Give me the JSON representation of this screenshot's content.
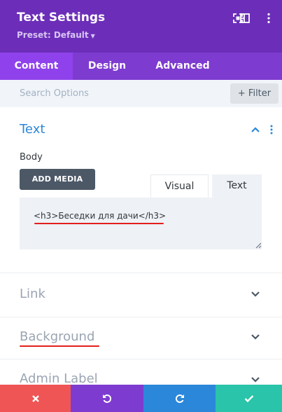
{
  "header": {
    "title": "Text Settings",
    "preset_label": "Preset: Default",
    "icons": [
      "expand-icon",
      "split-view-icon",
      "more-vertical-icon"
    ]
  },
  "tabs": [
    {
      "label": "Content",
      "active": true
    },
    {
      "label": "Design",
      "active": false
    },
    {
      "label": "Advanced",
      "active": false
    }
  ],
  "search": {
    "placeholder": "Search Options",
    "filter_label": "Filter"
  },
  "text_section": {
    "title": "Text",
    "body_label": "Body",
    "add_media_label": "ADD MEDIA",
    "editor_tabs": [
      "Visual",
      "Text"
    ],
    "active_editor_tab": "Text",
    "content": "<h3>Беседки для дачи</h3>"
  },
  "sections": [
    {
      "title": "Link"
    },
    {
      "title": "Background"
    },
    {
      "title": "Admin Label"
    }
  ],
  "footer": {
    "buttons": [
      "close-button",
      "undo-button",
      "redo-button",
      "save-button"
    ],
    "colors": [
      "#ef5555",
      "#7e3bd0",
      "#2b87da",
      "#29c4a9"
    ]
  },
  "colors": {
    "header_bg": "#6c2eb9",
    "tabs_bg": "#7e3bd0",
    "active_tab_bg": "#8f42ec",
    "accent_blue": "#2b87da",
    "annotation_red": "#e41e1e"
  }
}
